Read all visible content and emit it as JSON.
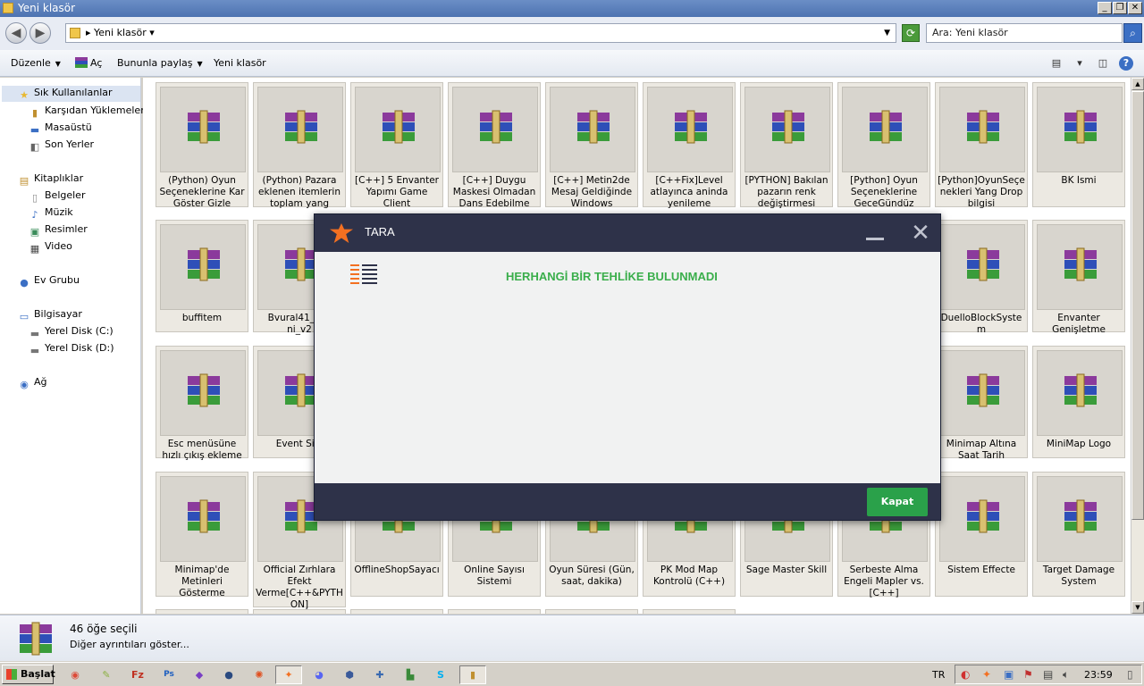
{
  "window": {
    "title": "Yeni klasör"
  },
  "address": {
    "path": "Yeni klasör",
    "search_placeholder": "Ara: Yeni klasör"
  },
  "toolbar": {
    "organize": "Düzenle",
    "open": "Aç",
    "share": "Bununla paylaş",
    "new_folder": "Yeni klasör"
  },
  "sidebar": {
    "favorites": "Sık Kullanılanlar",
    "downloads": "Karşıdan Yüklemeler",
    "desktop": "Masaüstü",
    "recent": "Son Yerler",
    "libraries": "Kitaplıklar",
    "documents": "Belgeler",
    "music": "Müzik",
    "pictures": "Resimler",
    "video": "Video",
    "homegroup": "Ev Grubu",
    "computer": "Bilgisayar",
    "disk_c": "Yerel Disk (C:)",
    "disk_d": "Yerel Disk (D:)",
    "network": "Ağ"
  },
  "files": [
    "(Python) Oyun Seçeneklerine Kar Göster Gizle",
    "(Python) Pazara eklenen itemlerin toplam yang mikt…",
    "[C++] 5 Envanter Yapımı Game  Client",
    "[C++] Duygu Maskesi Olmadan Dans Edebilme",
    "[C++] Metin2de Mesaj Geldiğinde Windows Penceresinde Uy…",
    "[C++Fix]Level atlayınca aninda yenileme",
    "[PYTHON] Bakılan pazarın renk değiştirmesi",
    "[Python] Oyun Seçeneklerine GeceGündüz",
    "[Python]OyunSeçenekleri Yang Drop bilgisi",
    "BK İsmi",
    "buffitem",
    "Bvural41_Giri ni_v2",
    "DuelloBlockSystem",
    "Envanter Genişletme",
    "Esc menüsüne hızlı çıkış ekleme",
    "Event Sist",
    "Minimap Altına Saat Tarih",
    "MiniMap Logo",
    "Minimap'de Metinleri Gösterme",
    "Official Zırhlara Efekt Verme[C++&PYTHON]",
    "OfflineShopSayacı",
    "Online Sayısı Sistemi",
    "Oyun Süresi (Gün, saat, dakika)",
    "PK Mod Map Kontrolü (C++)",
    "Sage Master Skill",
    "Serbeste Alma Engeli Mapler vs.[C++]",
    "Sistem Effecte",
    "Target Damage System"
  ],
  "status": {
    "selected": "46 öğe seçili",
    "details": "Diğer ayrıntıları göster..."
  },
  "taskbar": {
    "start": "Başlat",
    "lang": "TR",
    "clock": "23:59"
  },
  "dialog": {
    "title": "TARA",
    "message": "HERHANGİ BİR TEHLİKE BULUNMADI",
    "button": "Kapat"
  },
  "colors": {
    "dialog_header": "#2e3249",
    "message_green": "#3aae4b",
    "button_green": "#2aa14a",
    "avast_orange": "#f37021"
  }
}
